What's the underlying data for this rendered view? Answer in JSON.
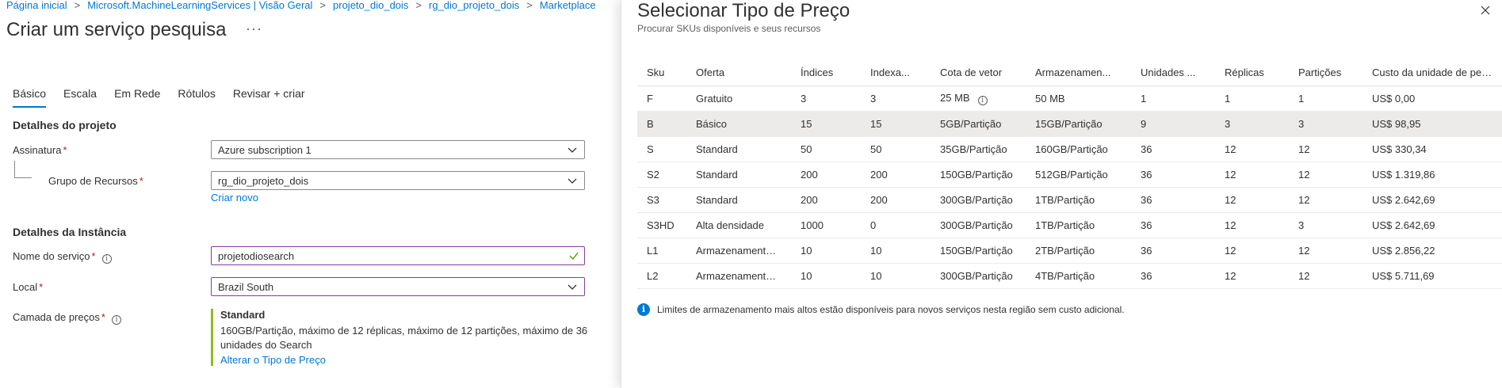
{
  "breadcrumb": [
    "Página inicial",
    "Microsoft.MachineLearningServices | Visão Geral",
    "projeto_dio_dois",
    "rg_dio_projeto_dois",
    "Marketplace"
  ],
  "page": {
    "title": "Criar um serviço pesquisa",
    "more_label": "···"
  },
  "tabs": [
    "Básico",
    "Escala",
    "Em Rede",
    "Rótulos",
    "Revisar + criar"
  ],
  "project_details": {
    "heading": "Detalhes do projeto",
    "subscription_label": "Assinatura",
    "subscription_value": "Azure subscription 1",
    "resource_group_label": "Grupo de Recursos",
    "resource_group_value": "rg_dio_projeto_dois",
    "create_new_link": "Criar novo"
  },
  "instance_details": {
    "heading": "Detalhes da Instância",
    "service_name_label": "Nome do serviço",
    "service_name_value": "projetodiosearch",
    "location_label": "Local",
    "location_value": "Brazil South",
    "pricing_label": "Camada de preços",
    "pricing_name": "Standard",
    "pricing_desc": "160GB/Partição, máximo de 12 réplicas, máximo de 12 partições, máximo de 36 unidades do Search",
    "pricing_link": "Alterar o Tipo de Preço"
  },
  "required_marker": "*",
  "info_glyph": "i",
  "panel": {
    "title": "Selecionar Tipo de Preço",
    "subtitle": "Procurar SKUs disponíveis e seus recursos",
    "notice": "Limites de armazenamento mais altos estão disponíveis para novos serviços nesta região sem custo adicional."
  },
  "sku_table": {
    "columns": [
      "Sku",
      "Oferta",
      "Índices",
      "Indexa...",
      "Cota de vetor",
      "Armazenamen...",
      "Unidades ...",
      "Réplicas",
      "Partições",
      "Custo da unidade de pesq..."
    ],
    "rows": [
      [
        "F",
        "Gratuito",
        "3",
        "3",
        "25 MB",
        "50 MB",
        "1",
        "1",
        "1",
        "US$ 0,00"
      ],
      [
        "B",
        "Básico",
        "15",
        "15",
        "5GB/Partição",
        "15GB/Partição",
        "9",
        "3",
        "3",
        "US$ 98,95"
      ],
      [
        "S",
        "Standard",
        "50",
        "50",
        "35GB/Partição",
        "160GB/Partição",
        "36",
        "12",
        "12",
        "US$ 330,34"
      ],
      [
        "S2",
        "Standard",
        "200",
        "200",
        "150GB/Partição",
        "512GB/Partição",
        "36",
        "12",
        "12",
        "US$ 1.319,86"
      ],
      [
        "S3",
        "Standard",
        "200",
        "200",
        "300GB/Partição",
        "1TB/Partição",
        "36",
        "12",
        "12",
        "US$ 2.642,69"
      ],
      [
        "S3HD",
        "Alta densidade",
        "1000",
        "0",
        "300GB/Partição",
        "1TB/Partição",
        "36",
        "12",
        "3",
        "US$ 2.642,69"
      ],
      [
        "L1",
        "Armazenamento ...",
        "10",
        "10",
        "150GB/Partição",
        "2TB/Partição",
        "36",
        "12",
        "12",
        "US$ 2.856,22"
      ],
      [
        "L2",
        "Armazenamento ...",
        "10",
        "10",
        "300GB/Partição",
        "4TB/Partição",
        "36",
        "12",
        "12",
        "US$ 5.711,69"
      ]
    ],
    "selected_row": 1
  },
  "colors": {
    "accent": "#0078d4",
    "required": "#a4262c",
    "pricing_bar": "#8cbd18",
    "valid_border": "#8a3a9e",
    "selected_row": "#edebe9"
  }
}
